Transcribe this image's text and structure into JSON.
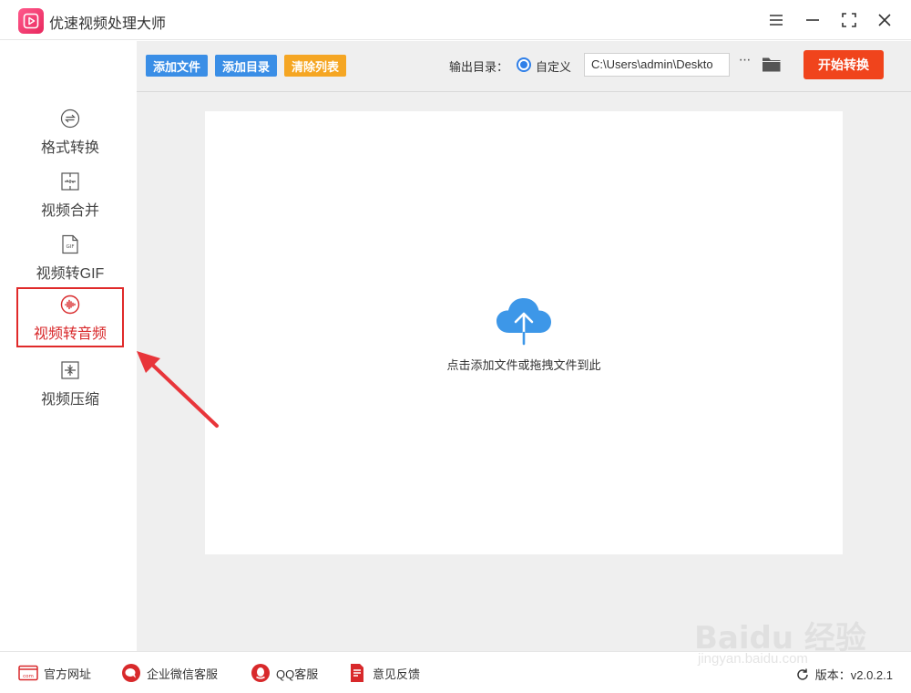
{
  "app": {
    "title": "优速视频处理大师"
  },
  "window_controls": [
    "menu-icon",
    "minimize-icon",
    "maximize-icon",
    "close-icon"
  ],
  "sidebar": {
    "items": [
      {
        "label": "格式转换",
        "icon": "format-convert-icon",
        "active": false
      },
      {
        "label": "视频合并",
        "icon": "video-merge-icon",
        "active": false
      },
      {
        "label": "视频转GIF",
        "icon": "gif-icon",
        "active": false
      },
      {
        "label": "视频转音频",
        "icon": "audio-wave-icon",
        "active": true
      },
      {
        "label": "视频压缩",
        "icon": "compress-icon",
        "active": false
      }
    ]
  },
  "toolbar": {
    "add_file": "添加文件",
    "add_folder": "添加目录",
    "clear_list": "清除列表",
    "output_label": "输出目录：",
    "custom_option": "自定义",
    "output_path": "C:\\Users\\admin\\Deskto",
    "more": "···",
    "start": "开始转换"
  },
  "dropzone": {
    "hint": "点击添加文件或拖拽文件到此"
  },
  "footer": {
    "links": [
      {
        "label": "官方网址",
        "icon": "website-icon"
      },
      {
        "label": "企业微信客服",
        "icon": "wechat-icon"
      },
      {
        "label": "QQ客服",
        "icon": "qq-icon"
      },
      {
        "label": "意见反馈",
        "icon": "feedback-icon"
      }
    ],
    "version": "版本：v2.0.2.1"
  },
  "watermark": {
    "brand": "Baidu 经验",
    "url": "jingyan.baidu.com"
  },
  "colors": {
    "primary_blue": "#3a8ee6",
    "orange": "#f5a623",
    "start_red": "#f0441c",
    "active_red": "#d8292b"
  }
}
